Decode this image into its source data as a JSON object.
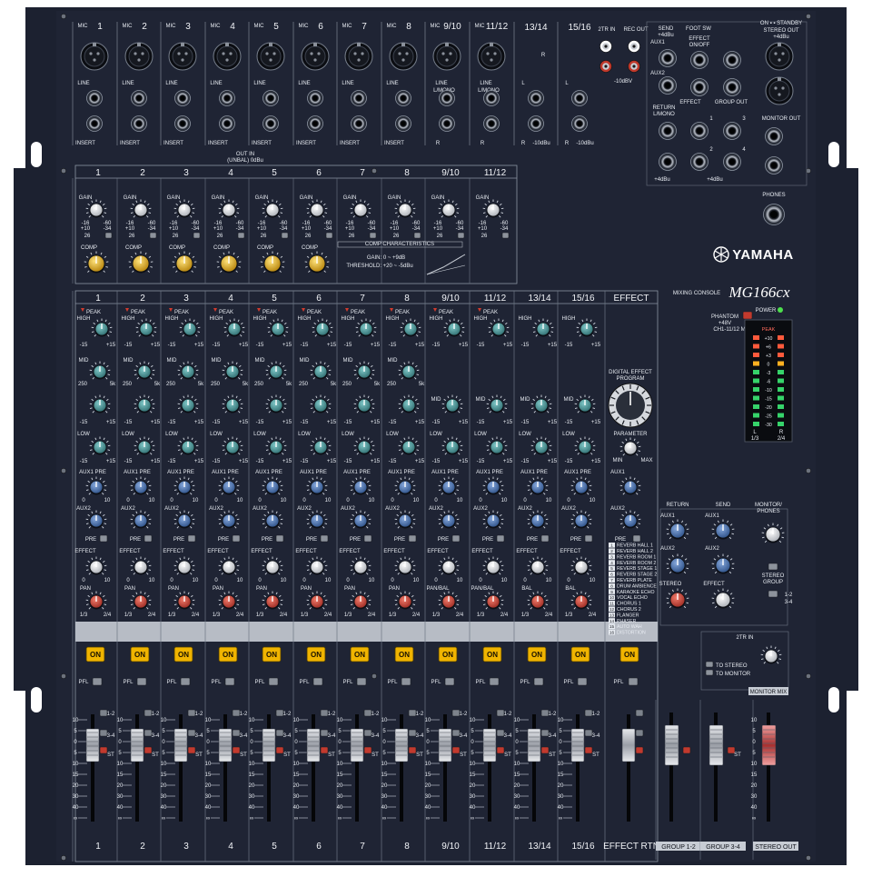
{
  "brand": "YAMAHA",
  "model_prefix": "MIXING CONSOLE",
  "model": "MG166cx",
  "mono_channels": [
    "1",
    "2",
    "3",
    "4",
    "5",
    "6",
    "7",
    "8"
  ],
  "stereo_channels": [
    "9/10",
    "11/12",
    "13/14",
    "15/16"
  ],
  "input_labels": {
    "mic": "MIC",
    "line": "LINE",
    "insert": "INSERT",
    "l_mono": "L/MONO",
    "r": "R",
    "l": "L",
    "level": "-10dBu",
    "out": "OUT",
    "in": "IN",
    "unbal": "(UNBAL) 0dBu"
  },
  "rear_panel": {
    "tr2_in": "2TR IN",
    "rec_out": "REC OUT",
    "rec_level": "-10dBV",
    "send": "SEND",
    "send_level": "+4dBu",
    "aux1": "AUX1",
    "aux2": "AUX2",
    "effect": "EFFECT",
    "return": "RETURN",
    "foot_sw": "FOOT SW",
    "effect_on_off": "EFFECT\nON/OFF",
    "group_out": "GROUP OUT",
    "standby": "ON ▪   ▪ STANDBY",
    "stereo_out": "STEREO OUT",
    "stereo_out_level": "+4dBu",
    "monitor_out": "MONITOR OUT",
    "phones": "PHONES",
    "level_4dbu": "+4dBu"
  },
  "gain_section": {
    "gain": "GAIN",
    "range_low": "-16",
    "range_high": "-60",
    "pad_low": "+10",
    "pad_high": "-34",
    "pad": "26",
    "comp": "COMP",
    "comp_characteristics": "COMP CHARACTERISTICS",
    "comp_gain": "GAIN:  0 ~ +9dB",
    "comp_threshold": "THRESHOLD: +20 ~ -5dBu"
  },
  "strip_labels": {
    "peak": "PEAK",
    "high": "HIGH",
    "mid": "MID",
    "low": "LOW",
    "freq_low": "250",
    "freq_high": "5k",
    "cut": "-15",
    "boost": "+15",
    "aux1_pre": "AUX1 PRE",
    "aux2": "AUX2",
    "effect": "EFFECT",
    "pan": "PAN",
    "pan_bal": "PAN/BAL",
    "bal": "BAL",
    "pre": "PRE",
    "on": "ON",
    "pfl": "PFL",
    "bus_12": "1-2",
    "bus_34": "3-4",
    "bus_st": "ST",
    "pan_l": "1/3",
    "pan_r": "2/4",
    "knob_min": "0",
    "knob_max": "10"
  },
  "fader_scale": [
    "10",
    "5",
    "0",
    "5",
    "10",
    "15",
    "20",
    "30",
    "40",
    "∞"
  ],
  "effect_section": {
    "title": "EFFECT",
    "program_title": "DIGITAL EFFECT\nPROGRAM",
    "parameter": "PARAMETER",
    "min": "MIN",
    "max": "MAX",
    "aux1": "AUX1",
    "aux2": "AUX2",
    "pre": "PRE",
    "programs": [
      {
        "n": "1",
        "name": "REVERB HALL 1"
      },
      {
        "n": "2",
        "name": "REVERB HALL 2"
      },
      {
        "n": "3",
        "name": "REVERB ROOM 1"
      },
      {
        "n": "4",
        "name": "REVERB ROOM 2"
      },
      {
        "n": "5",
        "name": "REVERB STAGE 1"
      },
      {
        "n": "6",
        "name": "REVERB STAGE 2"
      },
      {
        "n": "7",
        "name": "REVERB PLATE"
      },
      {
        "n": "8",
        "name": "DRUM AMBIENCE"
      },
      {
        "n": "9",
        "name": "KARAOKE ECHO"
      },
      {
        "n": "10",
        "name": "VOCAL ECHO"
      },
      {
        "n": "11",
        "name": "CHORUS 1"
      },
      {
        "n": "12",
        "name": "CHORUS 2"
      },
      {
        "n": "13",
        "name": "FLANGER"
      },
      {
        "n": "14",
        "name": "PHASER"
      },
      {
        "n": "15",
        "name": "AUTO WAH"
      },
      {
        "n": "16",
        "name": "DISTORTION"
      }
    ]
  },
  "master_section": {
    "phantom": "PHANTOM\n+48V",
    "phantom_sub": "CH1-11/12 MIC",
    "power": "POWER",
    "peak": "PEAK",
    "meter_scale": [
      "+10",
      "+6",
      "+3",
      "0",
      "-3",
      "-6",
      "-10",
      "-15",
      "-20",
      "-25",
      "-30"
    ],
    "meter_l": "L",
    "meter_r": "R",
    "meter_13": "1/3",
    "meter_24": "2/4",
    "return": "RETURN",
    "send": "SEND",
    "monitor_phones": "MONITOR/\nPHONES",
    "aux1": "AUX1",
    "aux2": "AUX2",
    "stereo": "STEREO",
    "effect": "EFFECT",
    "stereo_group": "STEREO\nGROUP",
    "g12": "1-2",
    "g34": "3-4",
    "tr2_in": "2TR IN",
    "to_stereo": "TO STEREO",
    "to_monitor": "TO MONITOR",
    "monitor_mix": "MONITOR MIX",
    "st": "ST"
  },
  "bottom_labels": {
    "effect_rtn": "EFFECT  RTN",
    "group12": "GROUP  1-2",
    "group34": "GROUP  3-4",
    "stereo_out": "STEREO OUT"
  },
  "colors": {
    "panel": "#1d2230",
    "knob_teal": "#3f8f8f",
    "knob_blue": "#3a66a8",
    "knob_white": "#eaeaea",
    "knob_red": "#c0392b",
    "comp_yellow": "#e7b320",
    "on_button": "#f0b400",
    "fader_grey": "#b4b8c0",
    "fader_red": "#c84040"
  }
}
